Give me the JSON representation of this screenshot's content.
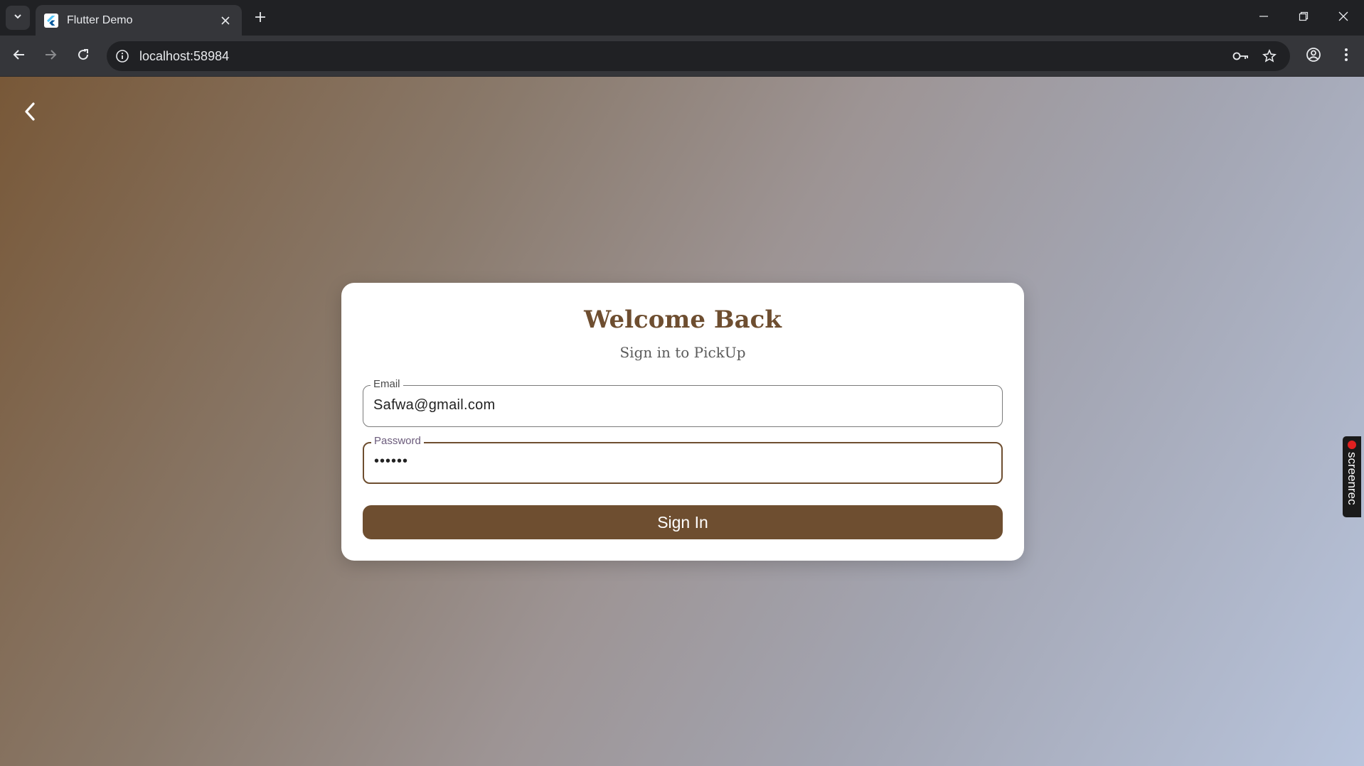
{
  "browser": {
    "tab_title": "Flutter Demo",
    "url": "localhost:58984",
    "icons": {
      "tab_search": "chevron-down-icon",
      "favicon": "flutter-logo-icon",
      "tab_close": "close-icon",
      "new_tab": "plus-icon",
      "minimize": "minimize-icon",
      "restore": "restore-icon",
      "close_window": "close-icon",
      "back": "arrow-left-icon",
      "forward": "arrow-right-icon",
      "reload": "reload-icon",
      "site_info": "info-icon",
      "password_key": "key-icon",
      "bookmark": "star-icon",
      "profile": "profile-icon",
      "menu": "more-vert-icon"
    }
  },
  "page": {
    "back_icon": "chevron-left-icon",
    "card": {
      "title": "Welcome Back",
      "subtitle": "Sign in to PickUp",
      "email": {
        "label": "Email",
        "value": "Safwa@gmail.com"
      },
      "password": {
        "label": "Password",
        "value": "••••••"
      },
      "submit_label": "Sign In"
    }
  },
  "overlay": {
    "screenrec_label": "screenrec"
  },
  "colors": {
    "accent_brown": "#6e4e30",
    "browser_dark": "#202124",
    "browser_toolbar": "#35363a",
    "focus_label": "#6b5b7b",
    "gradient_start": "#785838",
    "gradient_end": "#b8c4dc",
    "record_dot": "#e02020"
  }
}
